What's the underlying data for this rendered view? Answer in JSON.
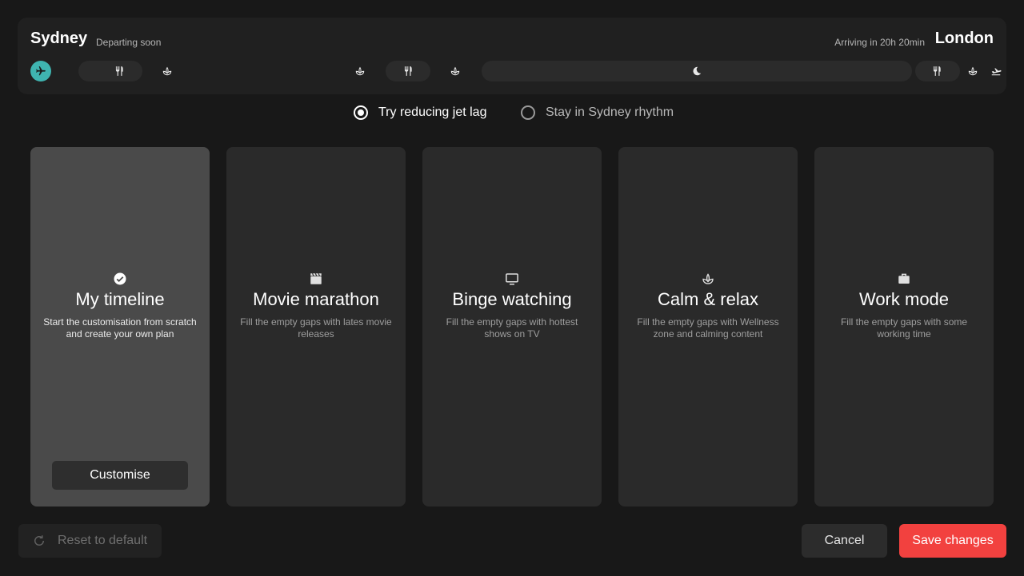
{
  "flight": {
    "origin": "Sydney",
    "status": "Departing soon",
    "arrival": "Arriving in 20h 20min",
    "destination": "London"
  },
  "timeline_icons": [
    "plane-icon",
    "meal-icon",
    "wellness-icon",
    "wellness-icon",
    "meal-icon",
    "wellness-icon",
    "moon-icon",
    "meal-icon",
    "wellness-icon",
    "landing-icon"
  ],
  "rhythm_options": [
    {
      "label": "Try reducing jet lag",
      "selected": true
    },
    {
      "label": "Stay in Sydney rhythm",
      "selected": false
    }
  ],
  "cards": [
    {
      "icon": "check-circle-icon",
      "title": "My timeline",
      "description": "Start the customisation from scratch and create your own plan",
      "selected": true,
      "action": "Customise"
    },
    {
      "icon": "clapperboard-icon",
      "title": "Movie marathon",
      "description": "Fill the empty gaps with lates movie releases",
      "selected": false
    },
    {
      "icon": "tv-icon",
      "title": "Binge watching",
      "description": "Fill the empty gaps with hottest shows on TV",
      "selected": false
    },
    {
      "icon": "lotus-icon",
      "title": "Calm & relax",
      "description": "Fill the empty gaps with Wellness zone and calming content",
      "selected": false
    },
    {
      "icon": "briefcase-icon",
      "title": "Work mode",
      "description": "Fill the empty gaps with some working time",
      "selected": false
    }
  ],
  "footer": {
    "reset_label": "Reset to default",
    "cancel_label": "Cancel",
    "save_label": "Save changes"
  },
  "colors": {
    "accent_plane": "#3fb4b0",
    "save_button": "#f2413f",
    "selected_card": "#4a4a4a",
    "card": "#2a2a2a",
    "background": "#181818"
  }
}
